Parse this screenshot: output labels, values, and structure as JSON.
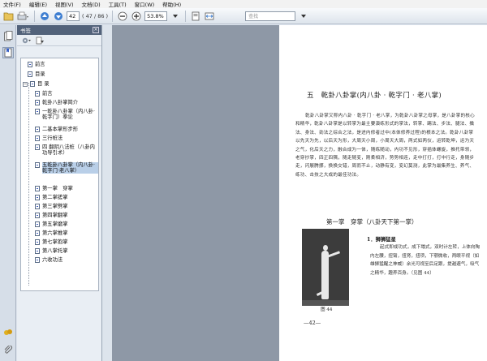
{
  "menu": [
    "文件(F)",
    "编辑(E)",
    "视图(V)",
    "文档(D)",
    "工具(T)",
    "窗口(W)",
    "帮助(H)"
  ],
  "toolbar": {
    "page_current": "42",
    "page_total": "( 47 / 86 )",
    "zoom": "53.8%",
    "search_placeholder": "查找"
  },
  "bookmarks": {
    "title": "书签",
    "items": [
      {
        "label": "前言"
      },
      {
        "label": "目录"
      },
      {
        "label": "目 录"
      },
      {
        "label": "前言"
      },
      {
        "label": "乾卦八卦掌简介"
      },
      {
        "label": "一乾卦八卦掌（内八卦·乾字门）拳论"
      },
      {
        "label": "二基本掌形步形"
      },
      {
        "label": "三行桩法"
      },
      {
        "label": "四 翻阴八法桩（八卦内功导引术）"
      },
      {
        "label": "五乾卦八卦掌（内八卦·乾字门·老八掌）"
      },
      {
        "label": "第一掌　穿掌"
      },
      {
        "label": "第二掌搓掌"
      },
      {
        "label": "第三掌劈掌"
      },
      {
        "label": "第四掌翻掌"
      },
      {
        "label": "第五掌磨掌"
      },
      {
        "label": "第六掌推掌"
      },
      {
        "label": "第七掌抱掌"
      },
      {
        "label": "第八掌托掌"
      },
      {
        "label": "六收功法"
      }
    ]
  },
  "page": {
    "chapter_title": "五　乾卦八卦掌(内八卦 · 乾字门 · 老八掌)",
    "paragraph": "乾卦八卦掌又称内八卦 · 乾字门 · 老八掌，为乾卦八卦掌之母掌，是八卦掌的核心和精华，乾卦八卦掌是以转掌为最主要演练形式的掌法，转掌、踢法、步法、腿法、擒法、身法、劲法之综合之法，是进内修者过中(本体修养过程)的根本之法。乾卦八卦掌以先天为先，以后天为形，大周天小周，小周天大周，两式如两仪，运转乾坤，运为天之气，化后天之力，融合成为一体，随练随动，内功不见形，穿插体螺旋，推托带领，老穿抄掌，四正四隅，随走随变，刚柔相济，势势相连，走中打打，打中行走，身随步走，闪展腾挪，换换交错，周而不止，动静有变，变幻莫测，此掌为最集养生、养气、练功、击技之大成的最佳功法。",
    "section_title": "第一掌　穿掌（八卦天下第一掌）",
    "move_title": "1．狮狮猛星",
    "move_text": "起式即成功式，成下塌式，双时计左转，上体向陶内左腰，扭臂，扭肾，扭项，下颚微收，两眼平视（如雄狮猛醒之神威）余光可视至后足跟，提越避气，吸气之精华，趣养百身。（见图 44）",
    "figure_caption": "图 44",
    "page_number": "—42—"
  },
  "colors": {
    "panel_header": "#52627a",
    "selection": "#b9cfe8",
    "page_bg": "#ffffff"
  }
}
